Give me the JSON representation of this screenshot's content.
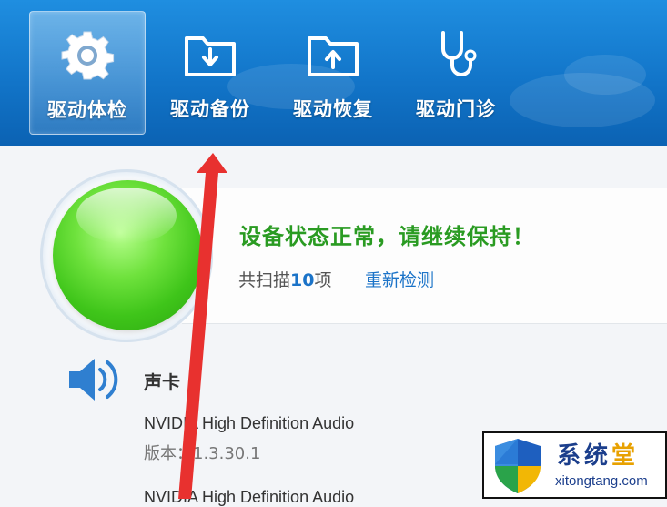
{
  "toolbar": {
    "tabs": [
      {
        "label": "驱动体检",
        "icon": "gear-icon",
        "active": true
      },
      {
        "label": "驱动备份",
        "icon": "folder-download-icon",
        "active": false
      },
      {
        "label": "驱动恢复",
        "icon": "folder-upload-icon",
        "active": false
      },
      {
        "label": "驱动门诊",
        "icon": "stethoscope-icon",
        "active": false
      }
    ]
  },
  "status": {
    "message": "设备状态正常，请继续保持！",
    "scan_prefix": "共扫描",
    "scan_count": "10",
    "scan_suffix": "项",
    "rescan_label": "重新检测",
    "color": "#2a9b22"
  },
  "devices": {
    "section_title": "声卡",
    "items": [
      {
        "name": "NVIDIA High Definition Audio",
        "version": "版本：1.3.30.1"
      },
      {
        "name": "NVIDIA High Definition Audio"
      }
    ]
  },
  "watermark": {
    "title_a": "系统",
    "title_b": "堂",
    "url": "xitongtang.com"
  },
  "colors": {
    "header": "#1275c9",
    "link": "#1b73c8",
    "arrow": "#e8312f"
  }
}
